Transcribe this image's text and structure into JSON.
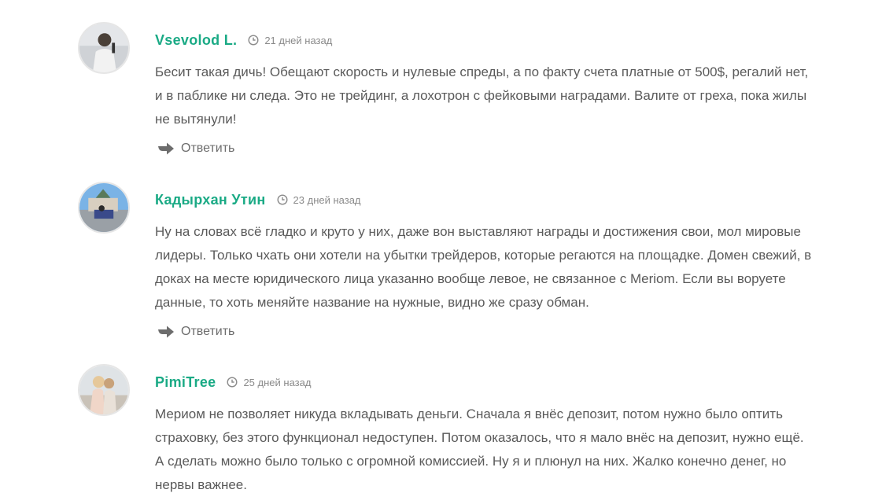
{
  "comments": [
    {
      "author": "Vsevolod L.",
      "date": "21 дней назад",
      "text": "Бесит такая дичь! Обещают скорость и нулевые спреды, а по факту счета платные от 500$, регалий нет, и в паблике ни следа. Это не трейдинг, а лохотрон с фейковыми наградами. Валите от греха, пока жилы не вытянули!",
      "reply_label": "Ответить",
      "avatar_icon": "user-photo-icon"
    },
    {
      "author": "Кадырхан Утин",
      "date": "23 дней назад",
      "text": "Ну на словах всё гладко и круто у них, даже вон выставляют награды и достижения свои, мол мировые лидеры. Только чхать они хотели на убытки трейдеров, которые регаются на площадке. Домен свежий, в доках на месте юридического лица указанно вообще левое, не связанное с Meriom. Если вы воруете данные, то хоть меняйте название на нужные, видно же сразу обман.",
      "reply_label": "Ответить",
      "avatar_icon": "user-photo-icon"
    },
    {
      "author": "PimiTree",
      "date": "25 дней назад",
      "text": "Мериом не позволяет никуда вкладывать деньги. Сначала я внёс депозит, потом нужно было оптить страховку, без этого функционал недоступен. Потом оказалось, что я мало внёс на депозит, нужно ещё. А сделать можно было только с огромной комиссией. Ну я и плюнул на них. Жалко конечно денег, но нервы важнее.",
      "avatar_icon": "user-photo-icon"
    }
  ],
  "colors": {
    "author": "#1aaa85",
    "text": "#5a5a5a",
    "meta": "#8a8a8a",
    "reply": "#6d6d6d"
  },
  "icons": {
    "date": "clock-icon",
    "reply": "reply-arrow-icon"
  }
}
